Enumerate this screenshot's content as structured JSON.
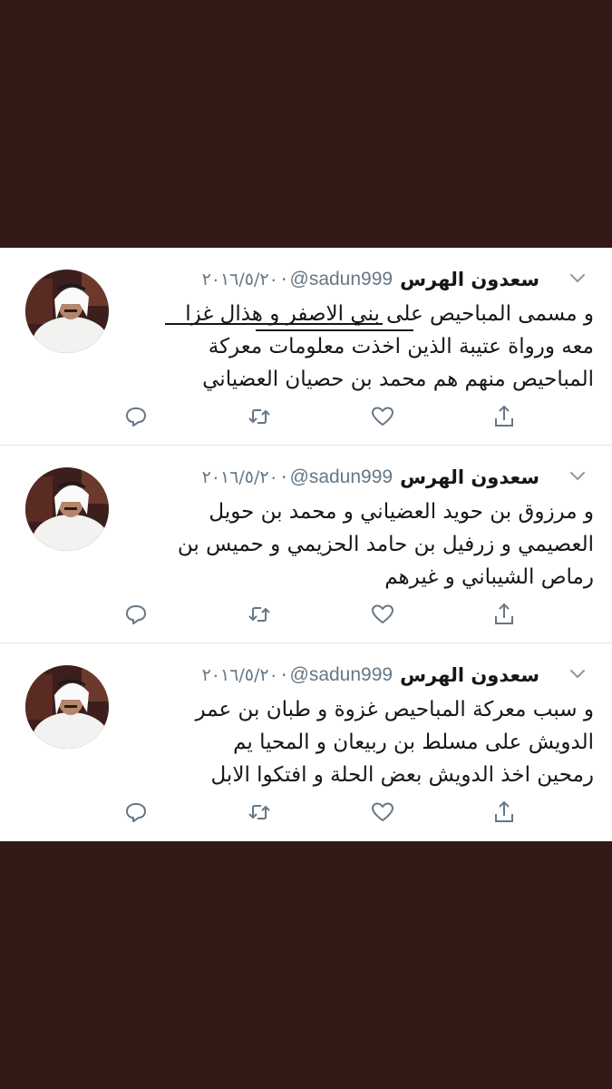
{
  "author": {
    "name": "سعدون الهرس",
    "handle": "@sadun999",
    "dot": "·",
    "date": "٢٠١٦/٥/٢٠"
  },
  "tweets": [
    {
      "lines": [
        "و مسمى المباحيص على بني الاصفر و هذال غزا",
        "معه ورواة عتيبة الذين اخذت معلومات معركة",
        "المباحيص منهم هم  محمد بن حصيان العضياني"
      ]
    },
    {
      "lines": [
        "و مرزوق بن حويد العضياني و محمد بن حويل",
        "العصيمي و زرفيل بن حامد الحزيمي و حميس بن",
        "رماص الشيباني  و غيرهم"
      ]
    },
    {
      "lines": [
        "و سبب معركة المباحيص  غزوة و طبان بن عمر",
        "الدويش  على مسلط بن ربيعان و المحيا يم",
        "رمحين اخذ الدويش بعض الحلة و افتكوا الابل"
      ]
    }
  ],
  "icons": {
    "reply": "reply-icon",
    "retweet": "retweet-icon",
    "like": "like-icon",
    "share": "share-icon",
    "menu": "chevron-down-icon"
  },
  "colors": {
    "background": "#331916",
    "card": "#ffffff",
    "text": "#14171a",
    "muted": "#657786",
    "divider": "#e1e4e8"
  }
}
